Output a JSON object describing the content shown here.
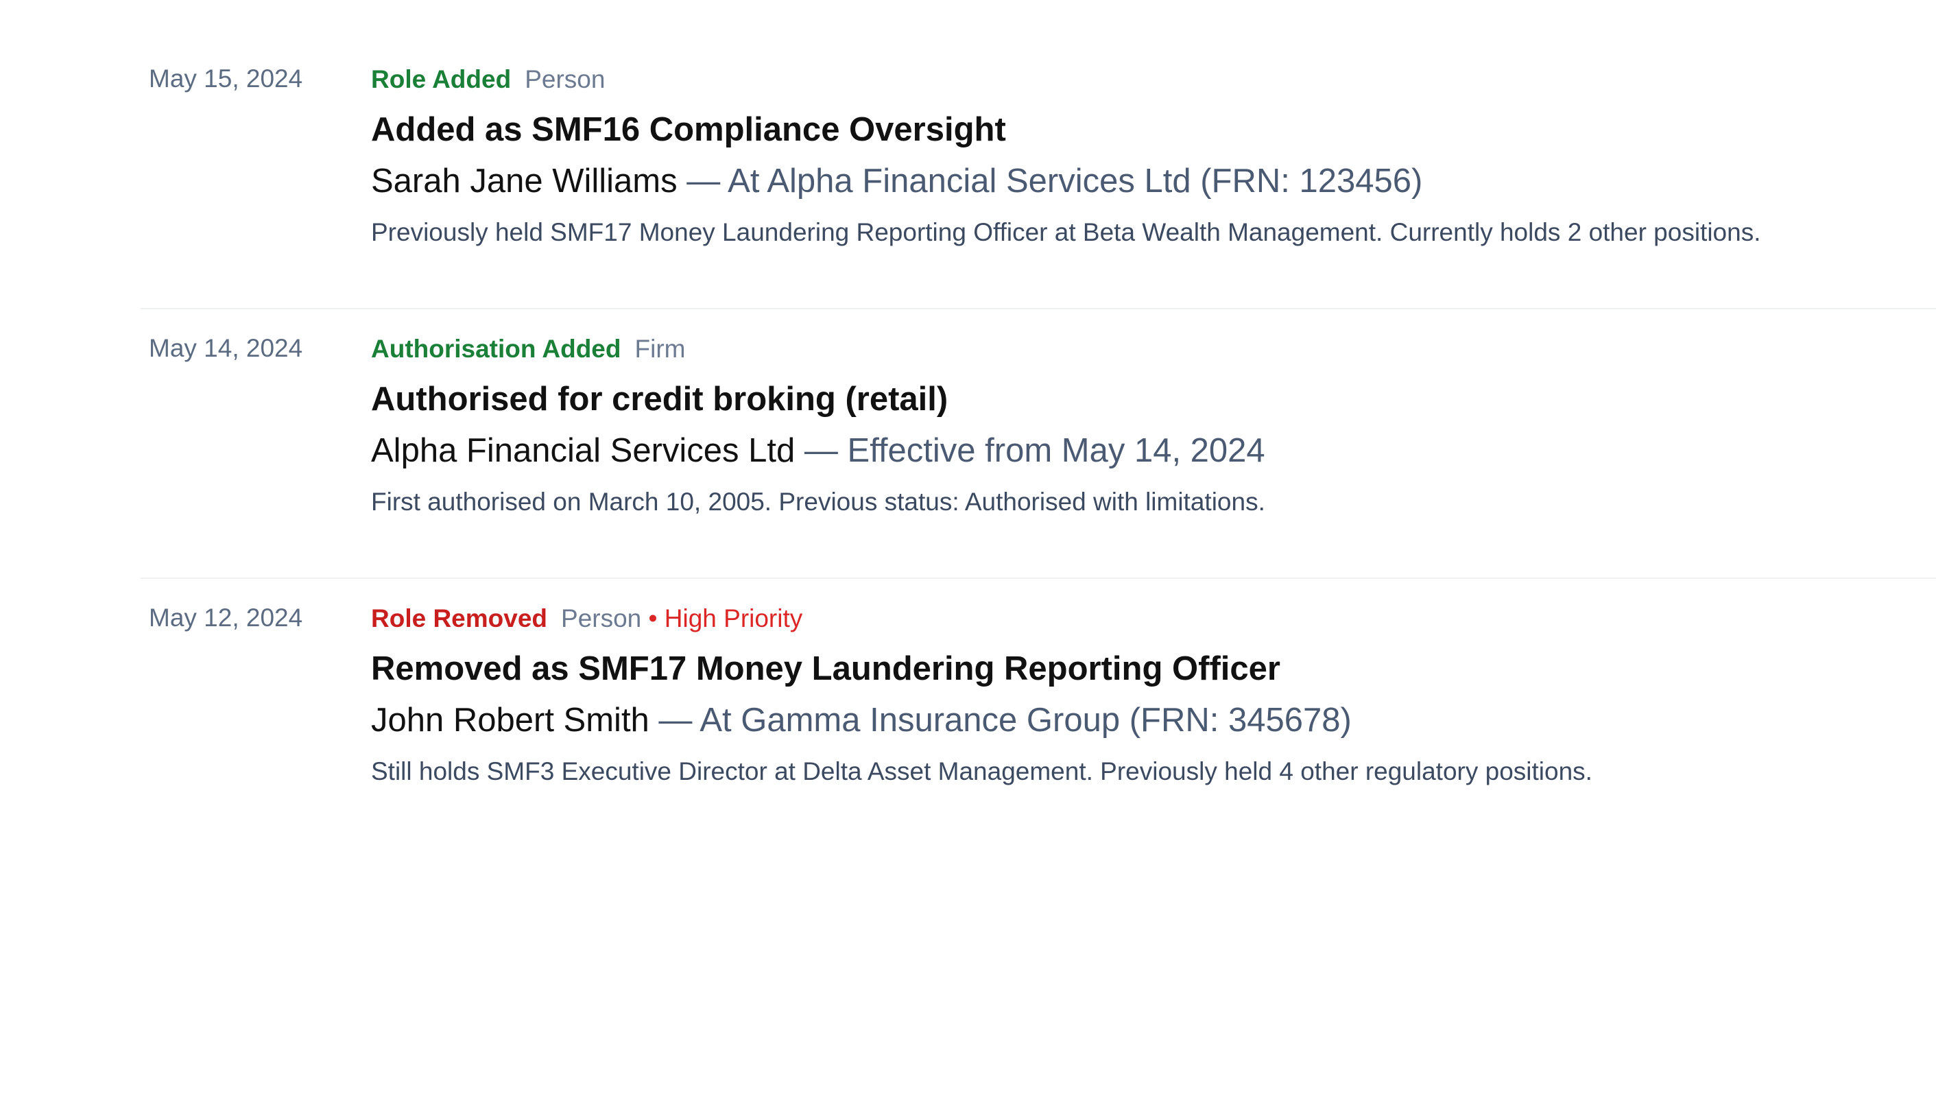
{
  "entries": [
    {
      "date": "May 15, 2024",
      "type": "Role Added",
      "type_color": "#1a7f37",
      "category": "Person",
      "priority": "",
      "title": "Added as SMF16 Compliance Oversight",
      "subject": "Sarah Jane Williams",
      "detail": " — At Alpha Financial Services Ltd (FRN: 123456)",
      "note": "Previously held SMF17 Money Laundering Reporting Officer at Beta Wealth Management. Currently holds 2 other positions."
    },
    {
      "date": "May 14, 2024",
      "type": "Authorisation Added",
      "type_color": "#1a7f37",
      "category": "Firm",
      "priority": "",
      "title": "Authorised for credit broking (retail)",
      "subject": "Alpha Financial Services Ltd",
      "detail": " — Effective from May 14, 2024",
      "note": "First authorised on March 10, 2005. Previous status: Authorised with limitations."
    },
    {
      "date": "May 12, 2024",
      "type": "Role Removed",
      "type_color": "#c81e1e",
      "category": "Person",
      "priority": " • High Priority",
      "title": "Removed as SMF17 Money Laundering Reporting Officer",
      "subject": "John Robert Smith",
      "detail": " — At Gamma Insurance Group (FRN: 345678)",
      "note": "Still holds SMF3 Executive Director at Delta Asset Management. Previously held 4 other regulatory positions."
    }
  ]
}
